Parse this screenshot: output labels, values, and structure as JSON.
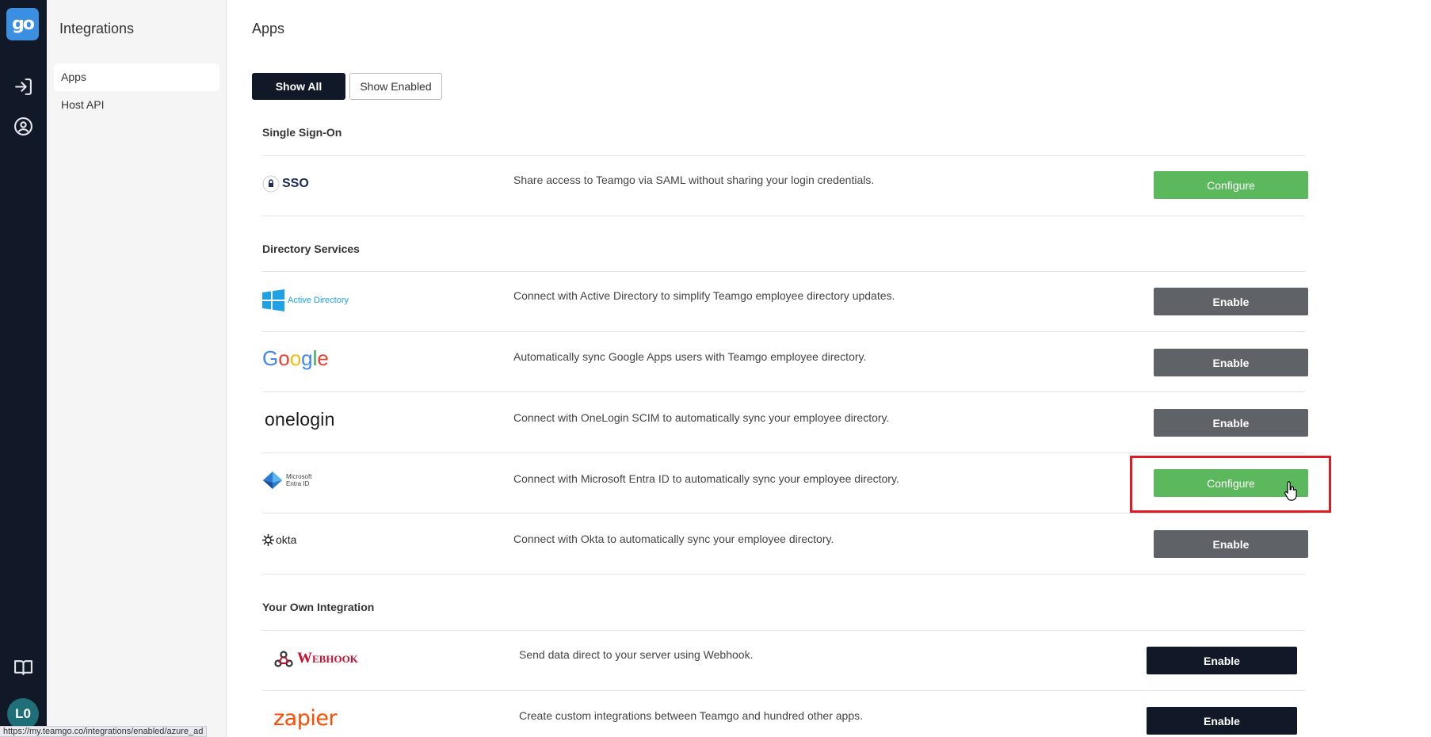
{
  "rail": {
    "logo_text": "go",
    "icons": [
      "login-icon",
      "user-circle-icon",
      "book-icon"
    ],
    "avatar_initials": "L0",
    "avatar_color": "#1f6f78"
  },
  "sidebar": {
    "title": "Integrations",
    "items": [
      {
        "label": "Apps",
        "active": true
      },
      {
        "label": "Host API",
        "active": false
      }
    ]
  },
  "main": {
    "title": "Apps",
    "filters": {
      "show_all": "Show All",
      "show_enabled": "Show Enabled"
    },
    "sections": [
      {
        "title": "Single Sign-On",
        "apps": [
          {
            "logo_text": "SSO",
            "description": "Share access to Teamgo via SAML without sharing your login credentials.",
            "action": "Configure"
          }
        ]
      },
      {
        "title": "Directory Services",
        "apps": [
          {
            "logo_text": "Active Directory",
            "description": "Connect with Active Directory to simplify Teamgo employee directory updates.",
            "action": "Enable"
          },
          {
            "logo_text": "Google",
            "description": "Automatically sync Google Apps users with Teamgo employee directory.",
            "action": "Enable"
          },
          {
            "logo_text": "onelogin",
            "description": "Connect with OneLogin SCIM to automatically sync your employee directory.",
            "action": "Enable"
          },
          {
            "logo_text": "Microsoft Entra ID",
            "description": "Connect with Microsoft Entra ID to automatically sync your employee directory.",
            "action": "Configure"
          },
          {
            "logo_text": "okta",
            "description": "Connect with Okta to automatically sync your employee directory.",
            "action": "Enable"
          }
        ]
      },
      {
        "title": "Your Own Integration",
        "apps": [
          {
            "logo_text": "Webhook",
            "description": "Send data direct to your server using Webhook.",
            "action": "Enable"
          },
          {
            "logo_text": "zapier",
            "description": "Create custom integrations between Teamgo and hundred other apps.",
            "action": "Enable"
          }
        ]
      }
    ]
  },
  "status_url": "https://my.teamgo.co/integrations/enabled/azure_ad",
  "colors": {
    "configure": "#5cb85c",
    "enable_grey": "#5f6368",
    "enable_dark": "#111827",
    "highlight": "#e01a22"
  }
}
